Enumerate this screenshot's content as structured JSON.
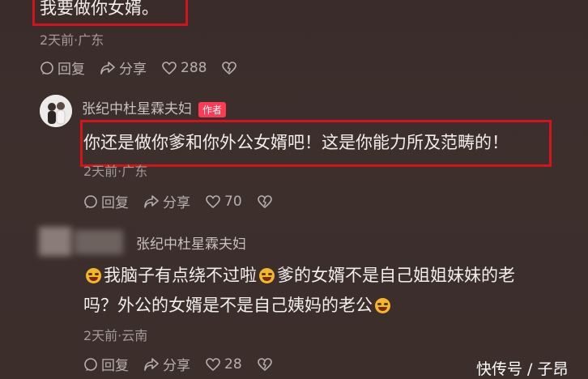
{
  "comment1": {
    "text": "我要做你女婿。",
    "meta": "2天前·广东",
    "reply": "回复",
    "share": "分享",
    "likes": "288"
  },
  "comment2": {
    "author": "张纪中杜星霖夫妇",
    "badge": "作者",
    "text": "你还是做你爹和你外公女婿吧！这是你能力所及范畴的！",
    "meta": "2天前·广东",
    "reply": "回复",
    "share": "分享",
    "likes": "70"
  },
  "comment3": {
    "author": "张纪中杜星霖夫妇",
    "line1_a": "我脑子有点绕不过啦",
    "line1_b": "爹的女婿不是自己姐姐妹妹的老",
    "line2": "吗？外公的女婿是不是自己姨妈的老公",
    "meta": "2天前·云南",
    "reply": "回复",
    "share": "分享",
    "likes": "28"
  },
  "icons": {
    "reply": "reply-bubble-icon",
    "share": "share-arrow-icon",
    "like": "heart-icon",
    "dislike": "broken-heart-icon",
    "emoji": "crying-laughing-emoji"
  },
  "colors": {
    "highlight_box": "#d4141c",
    "author_badge": "#ff3a55"
  },
  "watermark": "快传号 / 子昂"
}
